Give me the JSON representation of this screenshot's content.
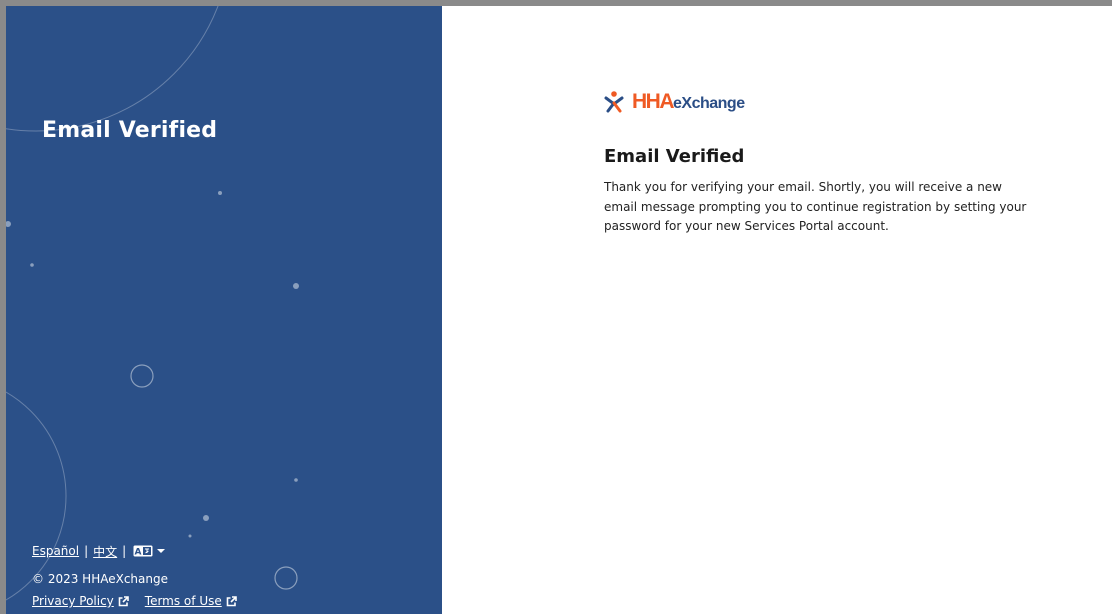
{
  "left_panel": {
    "title": "Email Verified",
    "bg_color": "#2b5088",
    "footer": {
      "lang_spanish": "Español",
      "lang_separator": "|",
      "lang_chinese": "中文",
      "translate_icon": "translate-icon",
      "copyright": "© 2023 HHAeXchange",
      "privacy_label": "Privacy Policy",
      "terms_label": "Terms of Use"
    }
  },
  "right_panel": {
    "logo": {
      "hha": "HHA",
      "exchange": "eXchange",
      "brand_orange": "#ef5a24",
      "brand_blue": "#2b4e86"
    },
    "title": "Email Verified",
    "message": "Thank you for verifying your email. Shortly, you will receive a new email message prompting you to continue registration by setting your password for your new Services Portal account."
  }
}
